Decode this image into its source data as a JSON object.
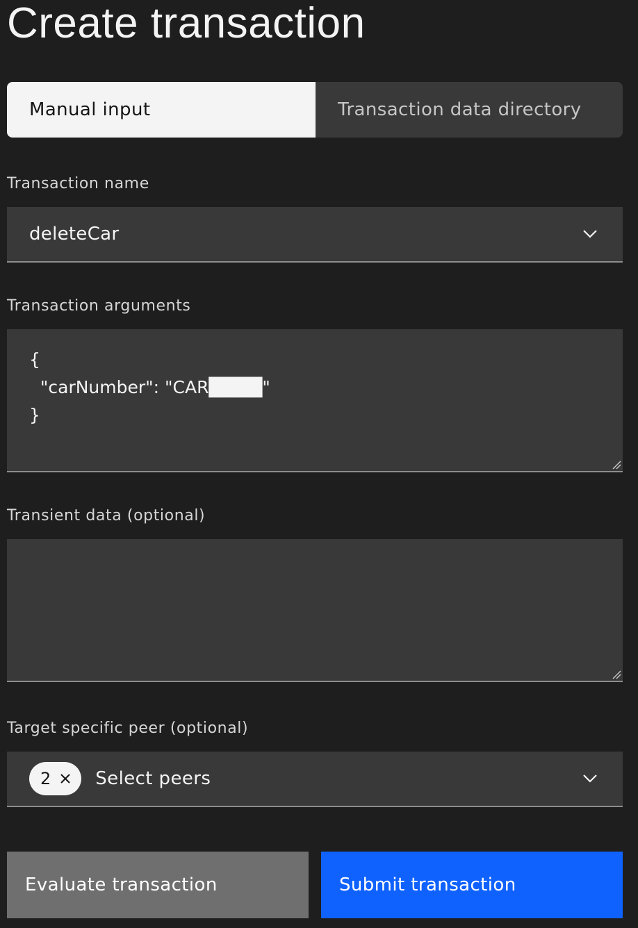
{
  "page": {
    "title": "Create transaction"
  },
  "tabs": [
    {
      "label": "Manual input",
      "active": true
    },
    {
      "label": "Transaction data directory",
      "active": false
    }
  ],
  "transaction_name": {
    "label": "Transaction name",
    "value": "deleteCar",
    "icon": "chevron-down-icon"
  },
  "transaction_arguments": {
    "label": "Transaction arguments",
    "value": "{\n  \"carNumber\": \"CAR████\"\n}"
  },
  "transient_data": {
    "label": "Transient data (optional)",
    "value": ""
  },
  "target_peer": {
    "label": "Target specific peer (optional)",
    "selected_count": "2",
    "placeholder": "Select peers",
    "icon": "chevron-down-icon"
  },
  "buttons": {
    "evaluate_label": "Evaluate transaction",
    "submit_label": "Submit transaction"
  },
  "colors": {
    "background": "#1e1e1e",
    "field": "#393939",
    "primary": "#0f62fe",
    "secondary": "#6f6f6f"
  }
}
